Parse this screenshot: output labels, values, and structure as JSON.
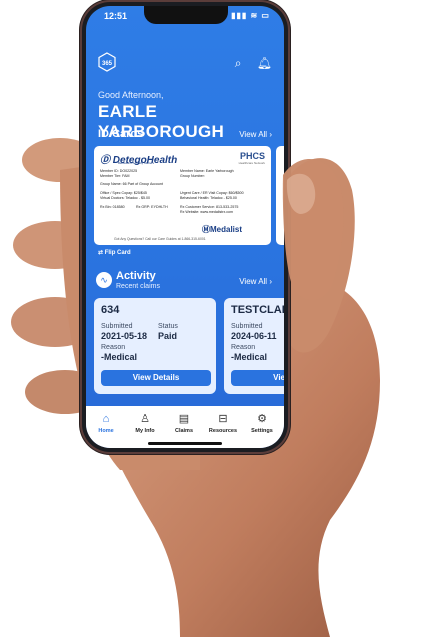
{
  "status_bar": {
    "time": "12:51",
    "indicators": "▮▮▮ ≋ ▭"
  },
  "app": {
    "logo_text": "365"
  },
  "header": {
    "greeting": "Good Afternoon,",
    "user_name": "EARLE YARBOROUGH"
  },
  "id_cards": {
    "section_title": "ID Cards",
    "view_all": "View All",
    "flip_label": "Flip Card",
    "card": {
      "brand": "DetegoHealth",
      "brand_sub": "Because it Actually Matters",
      "network": "PHCS",
      "network_sub": "Healthcare Network",
      "member_id": "Member ID: DO022025",
      "member_tier": "Member Tier: FAM",
      "member_name": "Member Name: Earle Yarborough",
      "group_number": "Group Number:",
      "group_name": "Group Name: 66 Part of Group Account",
      "office_copay": "Office / Spec Copay: $25/$45",
      "virtual_doctors": "Virtual Doctors: Teladoc - $5.00",
      "urgent_care": "Urgent Care / ER Visit Copay: $60/$500",
      "behavioral": "Behavioral Health: Teladoc - $25.00",
      "rx_bin": "Rx Bin: 018580",
      "rx_grp": "Rx GRP: EYDHLTH",
      "rx_customer": "Rx Customer Service: 813-533-2575",
      "rx_website": "Rx Website: www.medalistrx.com",
      "pharmacy": "Medalist",
      "footer": "Got Any Questions? Call our Care Guides at 1-866-315-6001"
    }
  },
  "activity": {
    "section_title": "Activity",
    "subtitle": "Recent claims",
    "view_all": "View All",
    "claims": [
      {
        "number": "634",
        "submitted_label": "Submitted",
        "submitted": "2021-05-18",
        "status_label": "Status",
        "status": "Paid",
        "reason_label": "Reason",
        "reason": "-Medical",
        "button": "View Details"
      },
      {
        "number": "TESTCLAI",
        "submitted_label": "Submitted",
        "submitted": "2024-06-11",
        "reason_label": "Reason",
        "reason": "-Medical",
        "button": "Vie"
      }
    ]
  },
  "tabbar": {
    "items": [
      {
        "label": "Home",
        "icon": "home-icon",
        "glyph": "⌂",
        "active": true
      },
      {
        "label": "My Info",
        "icon": "user-icon",
        "glyph": "♙",
        "active": false
      },
      {
        "label": "Claims",
        "icon": "document-icon",
        "glyph": "▤",
        "active": false
      },
      {
        "label": "Resources",
        "icon": "book-icon",
        "glyph": "⊟",
        "active": false
      },
      {
        "label": "Settings",
        "icon": "gear-icon",
        "glyph": "⚙",
        "active": false
      }
    ]
  },
  "colors": {
    "primary": "#2a73df",
    "card_bg": "#e6efff",
    "skin": "#c98b6b"
  }
}
